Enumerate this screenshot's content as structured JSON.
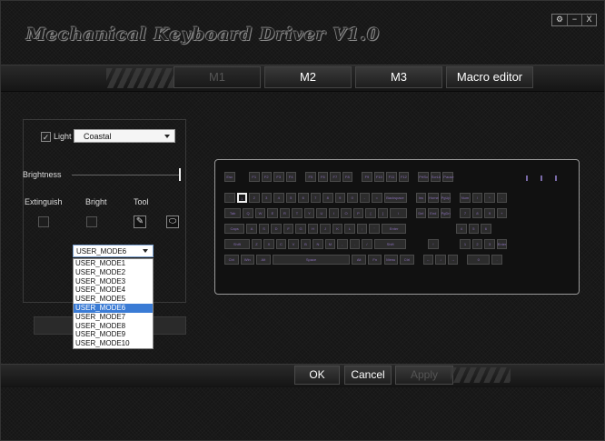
{
  "app": {
    "title": "Mechanical Keyboard Driver V1.0"
  },
  "window_controls": {
    "settings": "⚙",
    "minimize": "−",
    "close": "X"
  },
  "tabs": [
    {
      "label": "M1",
      "active": false
    },
    {
      "label": "M2",
      "active": true
    },
    {
      "label": "M3",
      "active": true
    },
    {
      "label": "Macro editor",
      "active": true
    }
  ],
  "light": {
    "checked": true,
    "check_glyph": "✓",
    "label": "Light",
    "effect_value": "Coastal",
    "brightness_label": "Brightness",
    "brightness_level": 1.0
  },
  "modes": {
    "extinguish_label": "Extinguish",
    "bright_label": "Bright",
    "tool_label": "Tool",
    "pen_glyph": "✎",
    "eraser_glyph": "⬭"
  },
  "user_mode": {
    "selected": "USER_MODE6",
    "options": [
      "USER_MODE1",
      "USER_MODE2",
      "USER_MODE3",
      "USER_MODE4",
      "USER_MODE5",
      "USER_MODE6",
      "USER_MODE7",
      "USER_MODE8",
      "USER_MODE9",
      "USER_MODE10"
    ]
  },
  "keyboard": {
    "selected_key": "1",
    "key_color": "#8a6fb8",
    "rows": [
      [
        "Esc",
        "F1",
        "F2",
        "F3",
        "F4",
        "F5",
        "F6",
        "F7",
        "F8",
        "F9",
        "F10",
        "F11",
        "F12",
        "PrtSc",
        "ScrLk",
        "Pause"
      ],
      [
        "`",
        "1",
        "2",
        "3",
        "4",
        "5",
        "6",
        "7",
        "8",
        "9",
        "0",
        "-",
        "=",
        "Backspace",
        "Ins",
        "Home",
        "PgUp",
        "Num",
        "/",
        "*",
        "-"
      ],
      [
        "Tab",
        "Q",
        "W",
        "E",
        "R",
        "T",
        "Y",
        "U",
        "I",
        "O",
        "P",
        "[",
        "]",
        "\\",
        "Del",
        "End",
        "PgDn",
        "7",
        "8",
        "9",
        "+"
      ],
      [
        "Caps",
        "A",
        "S",
        "D",
        "F",
        "G",
        "H",
        "J",
        "K",
        "L",
        ";",
        "'",
        "Enter",
        "4",
        "5",
        "6"
      ],
      [
        "Shift",
        "Z",
        "X",
        "C",
        "V",
        "B",
        "N",
        "M",
        ",",
        ".",
        "/",
        "Shift",
        "↑",
        "1",
        "2",
        "3",
        "Enter"
      ],
      [
        "Ctrl",
        "Win",
        "Alt",
        "Space",
        "Alt",
        "Fn",
        "Menu",
        "Ctrl",
        "←",
        "↓",
        "→",
        "0",
        "."
      ]
    ]
  },
  "actions": {
    "ok": "OK",
    "cancel": "Cancel",
    "apply": "Apply"
  }
}
